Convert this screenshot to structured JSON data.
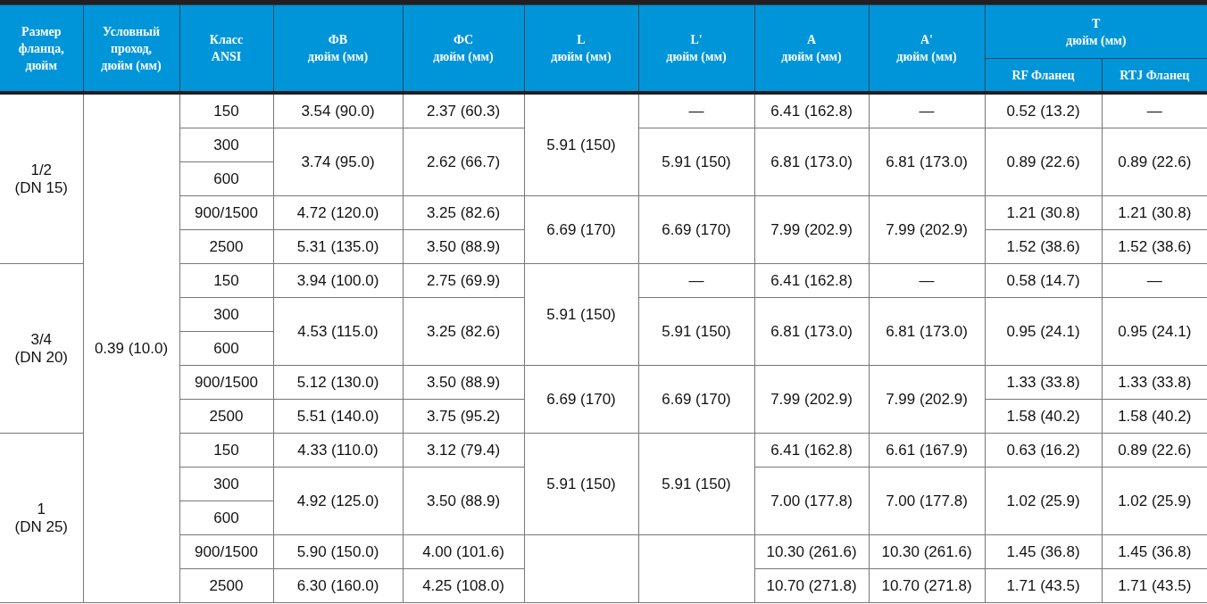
{
  "table": {
    "columns": [
      {
        "lines": [
          "Размер",
          "фланца,",
          "дюйм"
        ]
      },
      {
        "lines": [
          "Условный",
          "проход,",
          "дюйм (мм)"
        ]
      },
      {
        "lines": [
          "Класс",
          "ANSI"
        ]
      },
      {
        "lines": [
          "ФВ",
          "дюйм (мм)"
        ]
      },
      {
        "lines": [
          "ФС",
          "дюйм (мм)"
        ]
      },
      {
        "lines": [
          "L",
          "дюйм (мм)"
        ]
      },
      {
        "lines": [
          "L'",
          "дюйм (мм)"
        ]
      },
      {
        "lines": [
          "A",
          "дюйм (мм)"
        ]
      },
      {
        "lines": [
          "A'",
          "дюйм (мм)"
        ]
      },
      {
        "lines": [
          "T",
          "дюйм (мм)"
        ],
        "colspan": 2,
        "subcolumns": [
          "RF Фланец",
          "RTJ Фланец"
        ]
      }
    ],
    "rows": [
      [
        {
          "text": "1/2\n(DN 15)",
          "rowspan": 5
        },
        {
          "text": "0.39 (10.0)",
          "rowspan": 15
        },
        "150",
        "3.54 (90.0)",
        "2.37 (60.3)",
        {
          "text": "5.91 (150)",
          "rowspan": 3
        },
        "—",
        "6.41 (162.8)",
        "—",
        "0.52 (13.2)",
        "—"
      ],
      [
        "300",
        {
          "text": "3.74 (95.0)",
          "rowspan": 2
        },
        {
          "text": "2.62 (66.7)",
          "rowspan": 2
        },
        {
          "text": "5.91 (150)",
          "rowspan": 2
        },
        {
          "text": "6.81 (173.0)",
          "rowspan": 2
        },
        {
          "text": "6.81 (173.0)",
          "rowspan": 2
        },
        {
          "text": "0.89 (22.6)",
          "rowspan": 2
        },
        {
          "text": "0.89 (22.6)",
          "rowspan": 2
        }
      ],
      [
        "600"
      ],
      [
        "900/1500",
        "4.72 (120.0)",
        "3.25 (82.6)",
        {
          "text": "6.69 (170)",
          "rowspan": 2
        },
        {
          "text": "6.69 (170)",
          "rowspan": 2
        },
        {
          "text": "7.99 (202.9)",
          "rowspan": 2
        },
        {
          "text": "7.99 (202.9)",
          "rowspan": 2
        },
        "1.21 (30.8)",
        "1.21 (30.8)"
      ],
      [
        "2500",
        "5.31 (135.0)",
        "3.50 (88.9)",
        "1.52 (38.6)",
        "1.52 (38.6)"
      ],
      [
        {
          "text": "3/4\n(DN 20)",
          "rowspan": 5
        },
        "150",
        "3.94 (100.0)",
        "2.75 (69.9)",
        {
          "text": "5.91 (150)",
          "rowspan": 3
        },
        "—",
        "6.41 (162.8)",
        "—",
        "0.58 (14.7)",
        "—"
      ],
      [
        "300",
        {
          "text": "4.53 (115.0)",
          "rowspan": 2
        },
        {
          "text": "3.25 (82.6)",
          "rowspan": 2
        },
        {
          "text": "5.91 (150)",
          "rowspan": 2
        },
        {
          "text": "6.81 (173.0)",
          "rowspan": 2
        },
        {
          "text": "6.81 (173.0)",
          "rowspan": 2
        },
        {
          "text": "0.95 (24.1)",
          "rowspan": 2
        },
        {
          "text": "0.95 (24.1)",
          "rowspan": 2
        }
      ],
      [
        "600"
      ],
      [
        "900/1500",
        "5.12 (130.0)",
        "3.50 (88.9)",
        {
          "text": "6.69 (170)",
          "rowspan": 2
        },
        {
          "text": "6.69 (170)",
          "rowspan": 2
        },
        {
          "text": "7.99 (202.9)",
          "rowspan": 2
        },
        {
          "text": "7.99 (202.9)",
          "rowspan": 2
        },
        "1.33 (33.8)",
        "1.33 (33.8)"
      ],
      [
        "2500",
        "5.51 (140.0)",
        "3.75 (95.2)",
        "1.58 (40.2)",
        "1.58 (40.2)"
      ],
      [
        {
          "text": "1\n(DN 25)",
          "rowspan": 5
        },
        "150",
        "4.33 (110.0)",
        "3.12 (79.4)",
        {
          "text": "5.91 (150)",
          "rowspan": 3
        },
        {
          "text": "5.91 (150)",
          "rowspan": 3
        },
        "6.41 (162.8)",
        "6.61 (167.9)",
        "0.63 (16.2)",
        "0.89 (22.6)"
      ],
      [
        "300",
        {
          "text": "4.92 (125.0)",
          "rowspan": 2
        },
        {
          "text": "3.50 (88.9)",
          "rowspan": 2
        },
        {
          "text": "7.00 (177.8)",
          "rowspan": 2
        },
        {
          "text": "7.00 (177.8)",
          "rowspan": 2
        },
        {
          "text": "1.02 (25.9)",
          "rowspan": 2
        },
        {
          "text": "1.02 (25.9)",
          "rowspan": 2
        }
      ],
      [
        "600"
      ],
      [
        "900/1500",
        "5.90 (150.0)",
        "4.00 (101.6)",
        {
          "rowspan": 2
        },
        {
          "rowspan": 2
        },
        "10.30 (261.6)",
        "10.30 (261.6)",
        "1.45 (36.8)",
        "1.45 (36.8)"
      ],
      [
        "2500",
        "6.30 (160.0)",
        "4.25 (108.0)",
        "10.70 (271.8)",
        "10.70 (271.8)",
        "1.71 (43.5)",
        "1.71 (43.5)"
      ]
    ]
  }
}
